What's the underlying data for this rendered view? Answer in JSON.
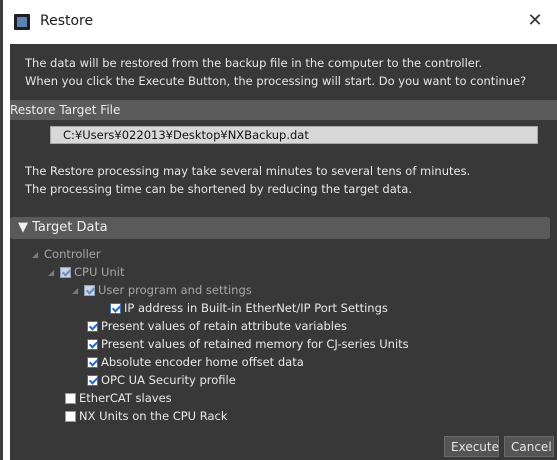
{
  "window": {
    "title": "Restore",
    "close_glyph": "✕"
  },
  "message": {
    "line1": "The data will be restored from the backup file in the computer to the controller.",
    "line2": "When you click the Execute Button, the processing will start. Do you want to continue?"
  },
  "restore_target": {
    "header": "Restore Target File",
    "file_path": "C:¥Users¥022013¥Desktop¥NXBackup.dat"
  },
  "note": {
    "line1": "The Restore processing may take several minutes to several tens of minutes.",
    "line2": "The processing time can be shortened by reducing the target data."
  },
  "target_data": {
    "header": "Target Data",
    "header_glyph": "▼",
    "items": [
      {
        "label": "Controller",
        "checkbox": "none",
        "state": "dim"
      },
      {
        "label": "CPU Unit",
        "checkbox": "checked-disabled",
        "state": "dim"
      },
      {
        "label": "User program and settings",
        "checkbox": "checked-disabled",
        "state": "dim"
      },
      {
        "label": "IP address in Built-in EtherNet/IP Port Settings",
        "checkbox": "checked"
      },
      {
        "label": "Present values of retain attribute variables",
        "checkbox": "checked"
      },
      {
        "label": "Present values of retained memory for CJ-series Units",
        "checkbox": "checked"
      },
      {
        "label": "Absolute encoder home offset data",
        "checkbox": "checked"
      },
      {
        "label": "OPC UA Security profile",
        "checkbox": "checked"
      },
      {
        "label": "EtherCAT slaves",
        "checkbox": "unchecked"
      },
      {
        "label": "NX Units on the CPU Rack",
        "checkbox": "unchecked"
      }
    ]
  },
  "buttons": {
    "execute": "Execute",
    "cancel": "Cancel"
  },
  "colors": {
    "panel_bg": "#383838",
    "section_header_bg": "#5b5b5b",
    "check_accent": "#2a68cc"
  }
}
